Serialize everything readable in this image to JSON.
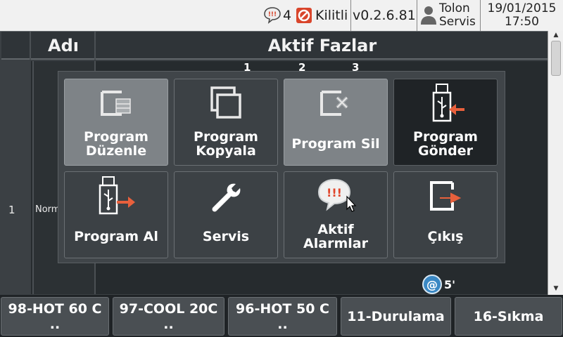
{
  "status": {
    "alarm_count": "4",
    "lock_label": "Kilitli",
    "version": "v0.2.6.81",
    "user_line1": "Tolon",
    "user_line2": "Servis",
    "date": "19/01/2015",
    "time": "17:50"
  },
  "table": {
    "header_name": "Adı",
    "header_phases": "Aktif Fazlar",
    "row_index": "1",
    "row_name": "Norm",
    "phase_ticks": [
      "1",
      "2",
      "3"
    ],
    "phase_time": "5'"
  },
  "menu": {
    "tiles": [
      {
        "line1": "Program",
        "line2": "Düzenle",
        "icon": "edit-program-icon"
      },
      {
        "line1": "Program",
        "line2": "Kopyala",
        "icon": "copy-icon"
      },
      {
        "line1": "Program Sil",
        "line2": "",
        "icon": "delete-program-icon"
      },
      {
        "line1": "Program",
        "line2": "Gönder",
        "icon": "usb-send-icon"
      },
      {
        "line1": "Program Al",
        "line2": "",
        "icon": "usb-receive-icon"
      },
      {
        "line1": "Servis",
        "line2": "",
        "icon": "wrench-icon"
      },
      {
        "line1": "Aktif",
        "line2": "Alarmlar",
        "icon": "alarm-bubble-icon"
      },
      {
        "line1": "Çıkış",
        "line2": "",
        "icon": "exit-icon"
      }
    ]
  },
  "programs": [
    {
      "line1": "98-HOT 60 C",
      "line2": ".."
    },
    {
      "line1": "97-COOL 20C",
      "line2": ".."
    },
    {
      "line1": "96-HOT 50 C",
      "line2": ".."
    },
    {
      "line1": "11-Durulama",
      "line2": ""
    },
    {
      "line1": "16-Sıkma",
      "line2": ""
    }
  ],
  "colors": {
    "accent": "#e8603c",
    "status_bg": "#f1f1f1",
    "lock_red": "#d9452b"
  }
}
